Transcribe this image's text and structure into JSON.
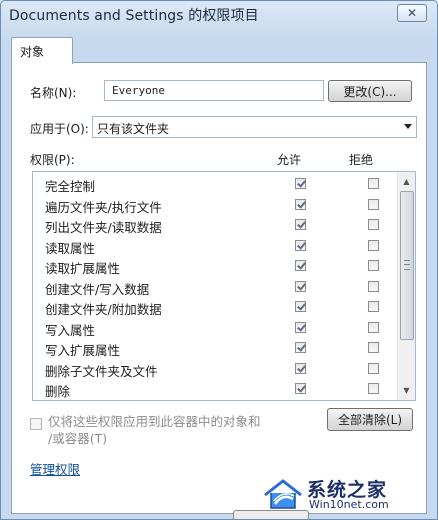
{
  "window": {
    "title": "Documents and Settings 的权限项目",
    "close_label": "✕"
  },
  "tabs": [
    {
      "label": "对象"
    }
  ],
  "name_field": {
    "label": "名称(N):",
    "value": "Everyone",
    "change_button": "更改(C)..."
  },
  "apply_to": {
    "label": "应用于(O):",
    "selected": "只有该文件夹"
  },
  "permissions": {
    "header": "权限(P):",
    "allow_header": "允许",
    "deny_header": "拒绝",
    "rows": [
      {
        "name": "完全控制",
        "allow": true,
        "deny": false
      },
      {
        "name": "遍历文件夹/执行文件",
        "allow": true,
        "deny": false
      },
      {
        "name": "列出文件夹/读取数据",
        "allow": true,
        "deny": false
      },
      {
        "name": "读取属性",
        "allow": true,
        "deny": false
      },
      {
        "name": "读取扩展属性",
        "allow": true,
        "deny": false
      },
      {
        "name": "创建文件/写入数据",
        "allow": true,
        "deny": false
      },
      {
        "name": "创建文件夹/附加数据",
        "allow": true,
        "deny": false
      },
      {
        "name": "写入属性",
        "allow": true,
        "deny": false
      },
      {
        "name": "写入扩展属性",
        "allow": true,
        "deny": false
      },
      {
        "name": "删除子文件夹及文件",
        "allow": true,
        "deny": false
      },
      {
        "name": "删除",
        "allow": true,
        "deny": false
      }
    ]
  },
  "apply_only": {
    "line1": "仅将这些权限应用到此容器中的对象和",
    "line2": "/或容器(T)"
  },
  "clear_all_button": "全部清除(L)",
  "manage_link": "管理权限",
  "watermark": {
    "name": "系统之家",
    "url": "Win10net.com"
  },
  "icons": {
    "scroll_up": "scroll-up-arrow",
    "scroll_down": "scroll-down-arrow",
    "dropdown": "chevron-down"
  }
}
